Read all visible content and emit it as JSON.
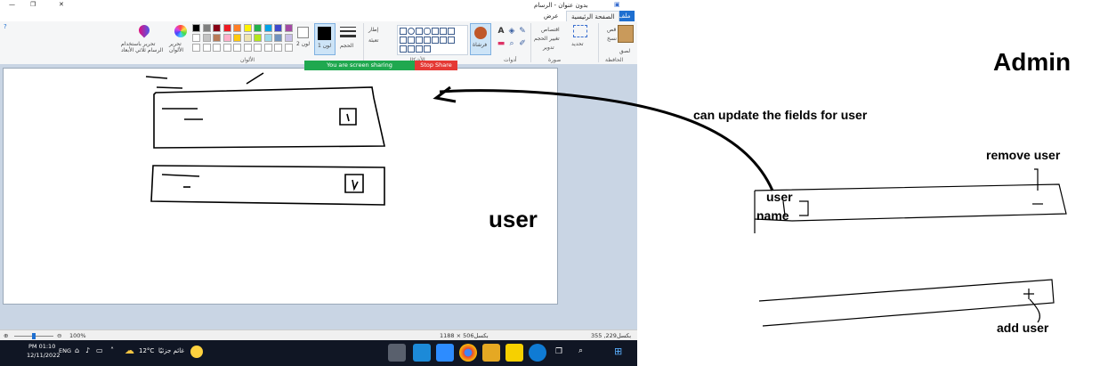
{
  "paint": {
    "title": "بدون عنوان - الرسام",
    "tabs": [
      "ملف",
      "الصفحة الرئيسية",
      "عرض"
    ],
    "ribbon": {
      "clipboard_group": "الحافظة",
      "paste_label": "لصق",
      "cut_label": "قص",
      "copy_label": "نسخ",
      "image_group": "صورة",
      "select_label": "تحديد",
      "crop_label": "اقتصاص",
      "resize_label": "تغيير الحجم",
      "rotate_label": "تدوير",
      "tools_group": "أدوات",
      "brush_label": "فرشاة",
      "shapes_group": "الأشكال",
      "outline_label": "إطار",
      "fill_label": "تعبئة",
      "size_label": "الحجم",
      "color1_label": "لون 1",
      "color2_label": "لون 2",
      "colors_group": "الألوان",
      "edit_colors_label": "تحرير الألوان",
      "paint3d_label": "تحرير باستخدام الرسام ثلاثي الأبعاد"
    },
    "palette_top": [
      "#000000",
      "#7f7f7f",
      "#880015",
      "#ed1c24",
      "#ff7f27",
      "#fff200",
      "#22b14c",
      "#00a2e8",
      "#3f48cc",
      "#a349a4"
    ],
    "palette_bottom": [
      "#ffffff",
      "#c3c3c3",
      "#b97a57",
      "#ffaec9",
      "#ffc90e",
      "#efe4b0",
      "#b5e61d",
      "#99d9ea",
      "#7092be",
      "#c8bfe7"
    ],
    "share_status": "You are screen sharing",
    "stop_share": "Stop Share",
    "canvas_label": "user",
    "status": {
      "zoom": "100%",
      "canvas_size": "1188 × 506بكسل",
      "cursor_pos": "355 ,229بكسل"
    },
    "taskbar": {
      "time": "PM 01:10",
      "date": "12/11/2022",
      "lang": "ENG",
      "weather_temp": "12°C",
      "weather_text": "غائم جزئيًا"
    }
  },
  "whiteboard": {
    "title": "Admin",
    "update_note": "can update the fields for user",
    "remove_user": "remove user",
    "field_user": "user",
    "field_name": "name",
    "add_user": "add user"
  }
}
